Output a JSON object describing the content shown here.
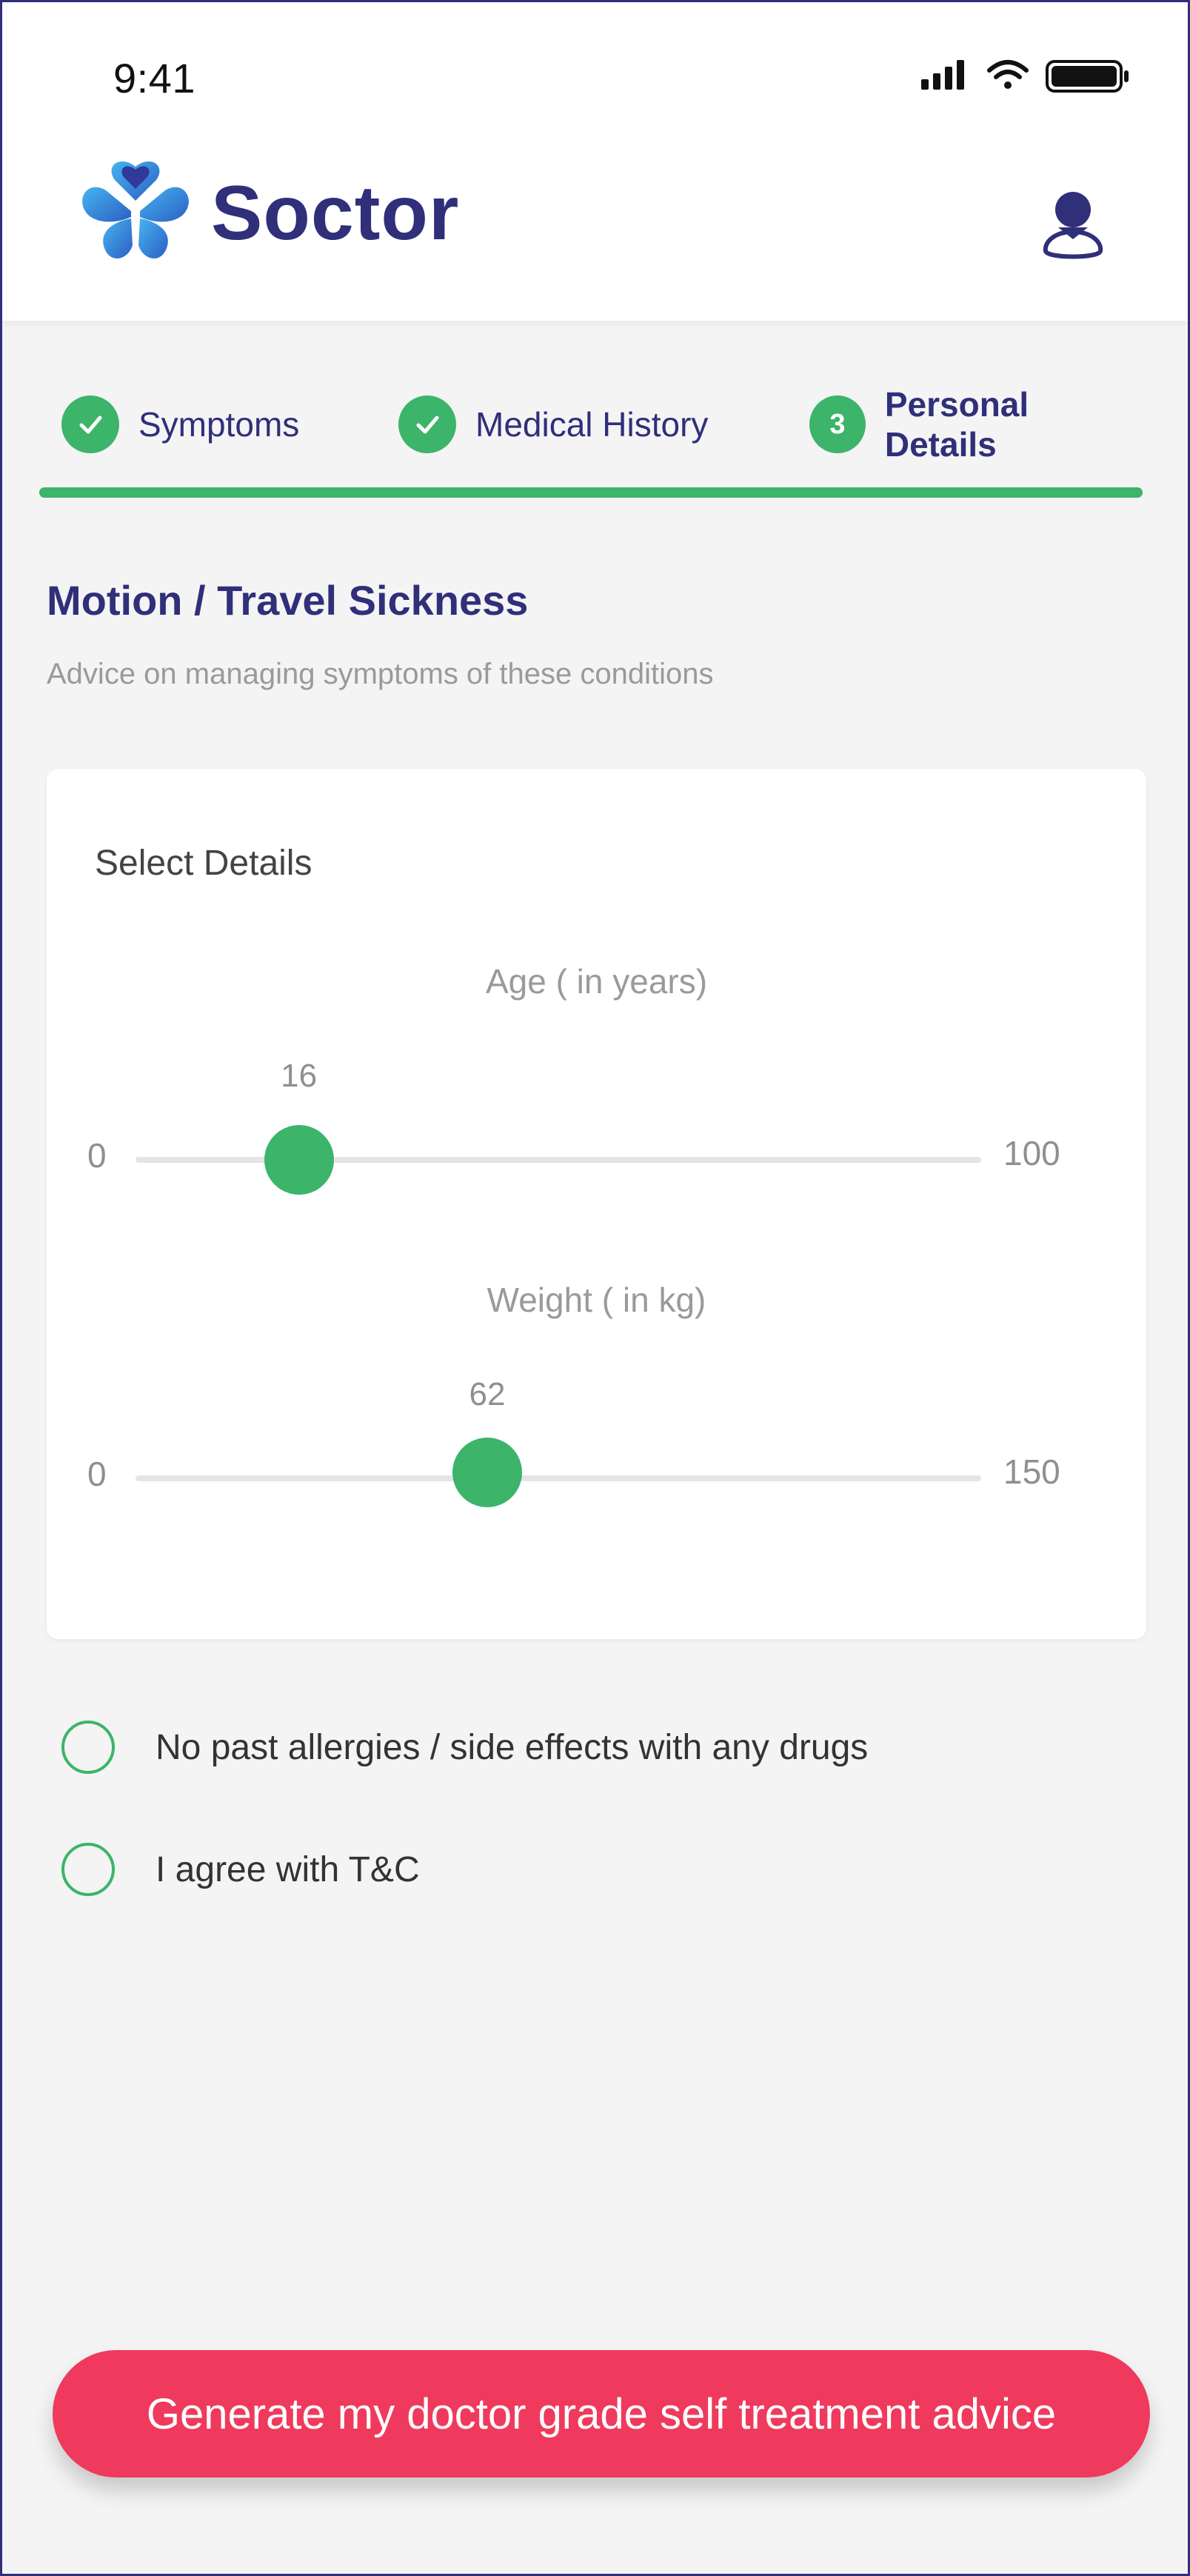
{
  "status_bar": {
    "time": "9:41"
  },
  "header": {
    "brand": "Soctor"
  },
  "stepper": {
    "steps": [
      {
        "label": "Symptoms",
        "state": "done",
        "marker": "check-icon"
      },
      {
        "label": "Medical History",
        "state": "done",
        "marker": "check-icon"
      },
      {
        "label": "Personal Details",
        "state": "active",
        "number": "3"
      }
    ],
    "progress": 1.0
  },
  "page": {
    "title": "Motion / Travel Sickness",
    "subtitle": "Advice on managing symptoms of these conditions"
  },
  "details_card": {
    "title": "Select Details",
    "sliders": [
      {
        "label": "Age ( in years)",
        "min": "0",
        "max": "100",
        "value": "16",
        "min_num": 0,
        "max_num": 100,
        "value_num": 16
      },
      {
        "label": "Weight ( in kg)",
        "min": "0",
        "max": "150",
        "value": "62",
        "min_num": 0,
        "max_num": 150,
        "value_num": 62
      }
    ]
  },
  "checkboxes": [
    {
      "label": "No past allergies / side effects with any drugs",
      "checked": false
    },
    {
      "label": "I agree with T&C",
      "checked": false
    }
  ],
  "cta": {
    "label": "Generate my doctor grade self treatment advice"
  },
  "colors": {
    "brand": "#2f2f7a",
    "accent_green": "#3cb46a",
    "cta_red": "#ef3a5d",
    "logo_blue": "#3a8ee6"
  }
}
